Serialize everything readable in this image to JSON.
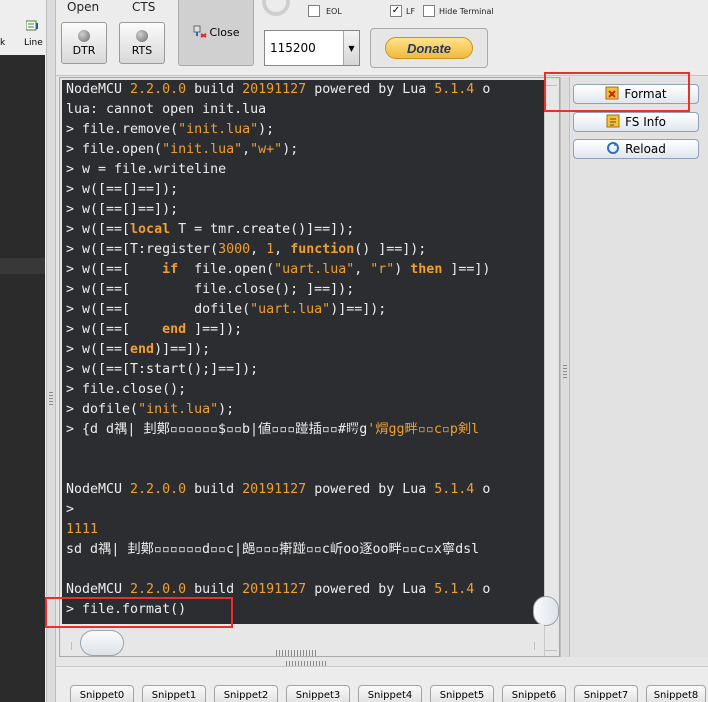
{
  "left_toolbar": {
    "item_1": "k",
    "item_2": "Line"
  },
  "toolbar": {
    "open_label": "Open",
    "cts_label": "CTS",
    "dtr_label": "DTR",
    "rts_label": "RTS",
    "close_label": "Close",
    "eol_label": "EOL",
    "lf_label": "LF",
    "lf_checked": true,
    "hide_terminal_label": "Hide Terminal",
    "baud_value": "115200",
    "donate_label": "Donate"
  },
  "terminal": {
    "lines": [
      [
        {
          "t": "NodeMCU "
        },
        {
          "t": "2.2.0.0",
          "c": "o"
        },
        {
          "t": " build "
        },
        {
          "t": "20191127",
          "c": "o"
        },
        {
          "t": " powered by Lua "
        },
        {
          "t": "5.1.4",
          "c": "o"
        },
        {
          "t": " o"
        }
      ],
      [
        {
          "t": "lua: cannot open init.lua"
        }
      ],
      [
        {
          "t": "> file.remove("
        },
        {
          "t": "\"init.lua\"",
          "c": "o"
        },
        {
          "t": ");"
        }
      ],
      [
        {
          "t": "> file.open("
        },
        {
          "t": "\"init.lua\"",
          "c": "o"
        },
        {
          "t": ","
        },
        {
          "t": "\"w+\"",
          "c": "o"
        },
        {
          "t": ");"
        }
      ],
      [
        {
          "t": "> w = file.writeline"
        }
      ],
      [
        {
          "t": "> w([==[]==]);"
        }
      ],
      [
        {
          "t": "> w([==[]==]);"
        }
      ],
      [
        {
          "t": "> w([==["
        },
        {
          "t": "local",
          "c": "k"
        },
        {
          "t": " T = tmr.create()]==]);"
        }
      ],
      [
        {
          "t": "> w([==[T:register("
        },
        {
          "t": "3000",
          "c": "o"
        },
        {
          "t": ", "
        },
        {
          "t": "1",
          "c": "o"
        },
        {
          "t": ", "
        },
        {
          "t": "function",
          "c": "k"
        },
        {
          "t": "() ]==]);"
        }
      ],
      [
        {
          "t": "> w([==[    "
        },
        {
          "t": "if",
          "c": "k"
        },
        {
          "t": "  file.open("
        },
        {
          "t": "\"uart.lua\"",
          "c": "o"
        },
        {
          "t": ", "
        },
        {
          "t": "\"r\"",
          "c": "o"
        },
        {
          "t": ") "
        },
        {
          "t": "then",
          "c": "k"
        },
        {
          "t": " ]==])"
        }
      ],
      [
        {
          "t": "> w([==[        file.close(); ]==]);"
        }
      ],
      [
        {
          "t": "> w([==[        dofile("
        },
        {
          "t": "\"uart.lua\"",
          "c": "o"
        },
        {
          "t": ")]==]);"
        }
      ],
      [
        {
          "t": "> w([==[    "
        },
        {
          "t": "end",
          "c": "k"
        },
        {
          "t": " ]==]);"
        }
      ],
      [
        {
          "t": "> w([==["
        },
        {
          "t": "end",
          "c": "k"
        },
        {
          "t": ")]==]);"
        }
      ],
      [
        {
          "t": "> w([==[T:start();]==]);"
        }
      ],
      [
        {
          "t": "> file.close();"
        }
      ],
      [
        {
          "t": "> dofile("
        },
        {
          "t": "\"init.lua\"",
          "c": "o"
        },
        {
          "t": ");"
        }
      ],
      [
        {
          "t": "> {d d禑| 刲鄚▫▫▫▫▫▫$▫▫b|値▫▫▫踫插▫▫#𥈭g"
        },
        {
          "t": "'焨gg畔▫▫c▫p剣l",
          "c": "o"
        }
      ],
      [],
      [],
      [
        {
          "t": "NodeMCU "
        },
        {
          "t": "2.2.0.0",
          "c": "o"
        },
        {
          "t": " build "
        },
        {
          "t": "20191127",
          "c": "o"
        },
        {
          "t": " powered by Lua "
        },
        {
          "t": "5.1.4",
          "c": "o"
        },
        {
          "t": " o"
        }
      ],
      [
        {
          "t": ">"
        }
      ],
      [
        {
          "t": "1111",
          "c": "o"
        }
      ],
      [
        {
          "t": "sd d禑| 刲鄚▫▫▫▫▫▫d▫▫c|郒▫▫▫搟踫▫▫c岓oo逐oo畔▫▫c▫x寧dsl"
        }
      ],
      [],
      [
        {
          "t": "NodeMCU "
        },
        {
          "t": "2.2.0.0",
          "c": "o"
        },
        {
          "t": " build "
        },
        {
          "t": "20191127",
          "c": "o"
        },
        {
          "t": " powered by Lua "
        },
        {
          "t": "5.1.4",
          "c": "o"
        },
        {
          "t": " o"
        }
      ],
      [
        {
          "t": "> file.format()"
        }
      ]
    ]
  },
  "side_panel": {
    "format_label": "Format",
    "fs_info_label": "FS Info",
    "reload_label": "Reload"
  },
  "snippets": [
    "Snippet0",
    "Snippet1",
    "Snippet2",
    "Snippet3",
    "Snippet4",
    "Snippet5",
    "Snippet6",
    "Snippet7",
    "Snippet8"
  ],
  "colors": {
    "terminal_bg": "#2b2d30",
    "terminal_text": "#ededed",
    "syntax_accent": "#f0a030",
    "highlight_box": "#e5322e"
  }
}
